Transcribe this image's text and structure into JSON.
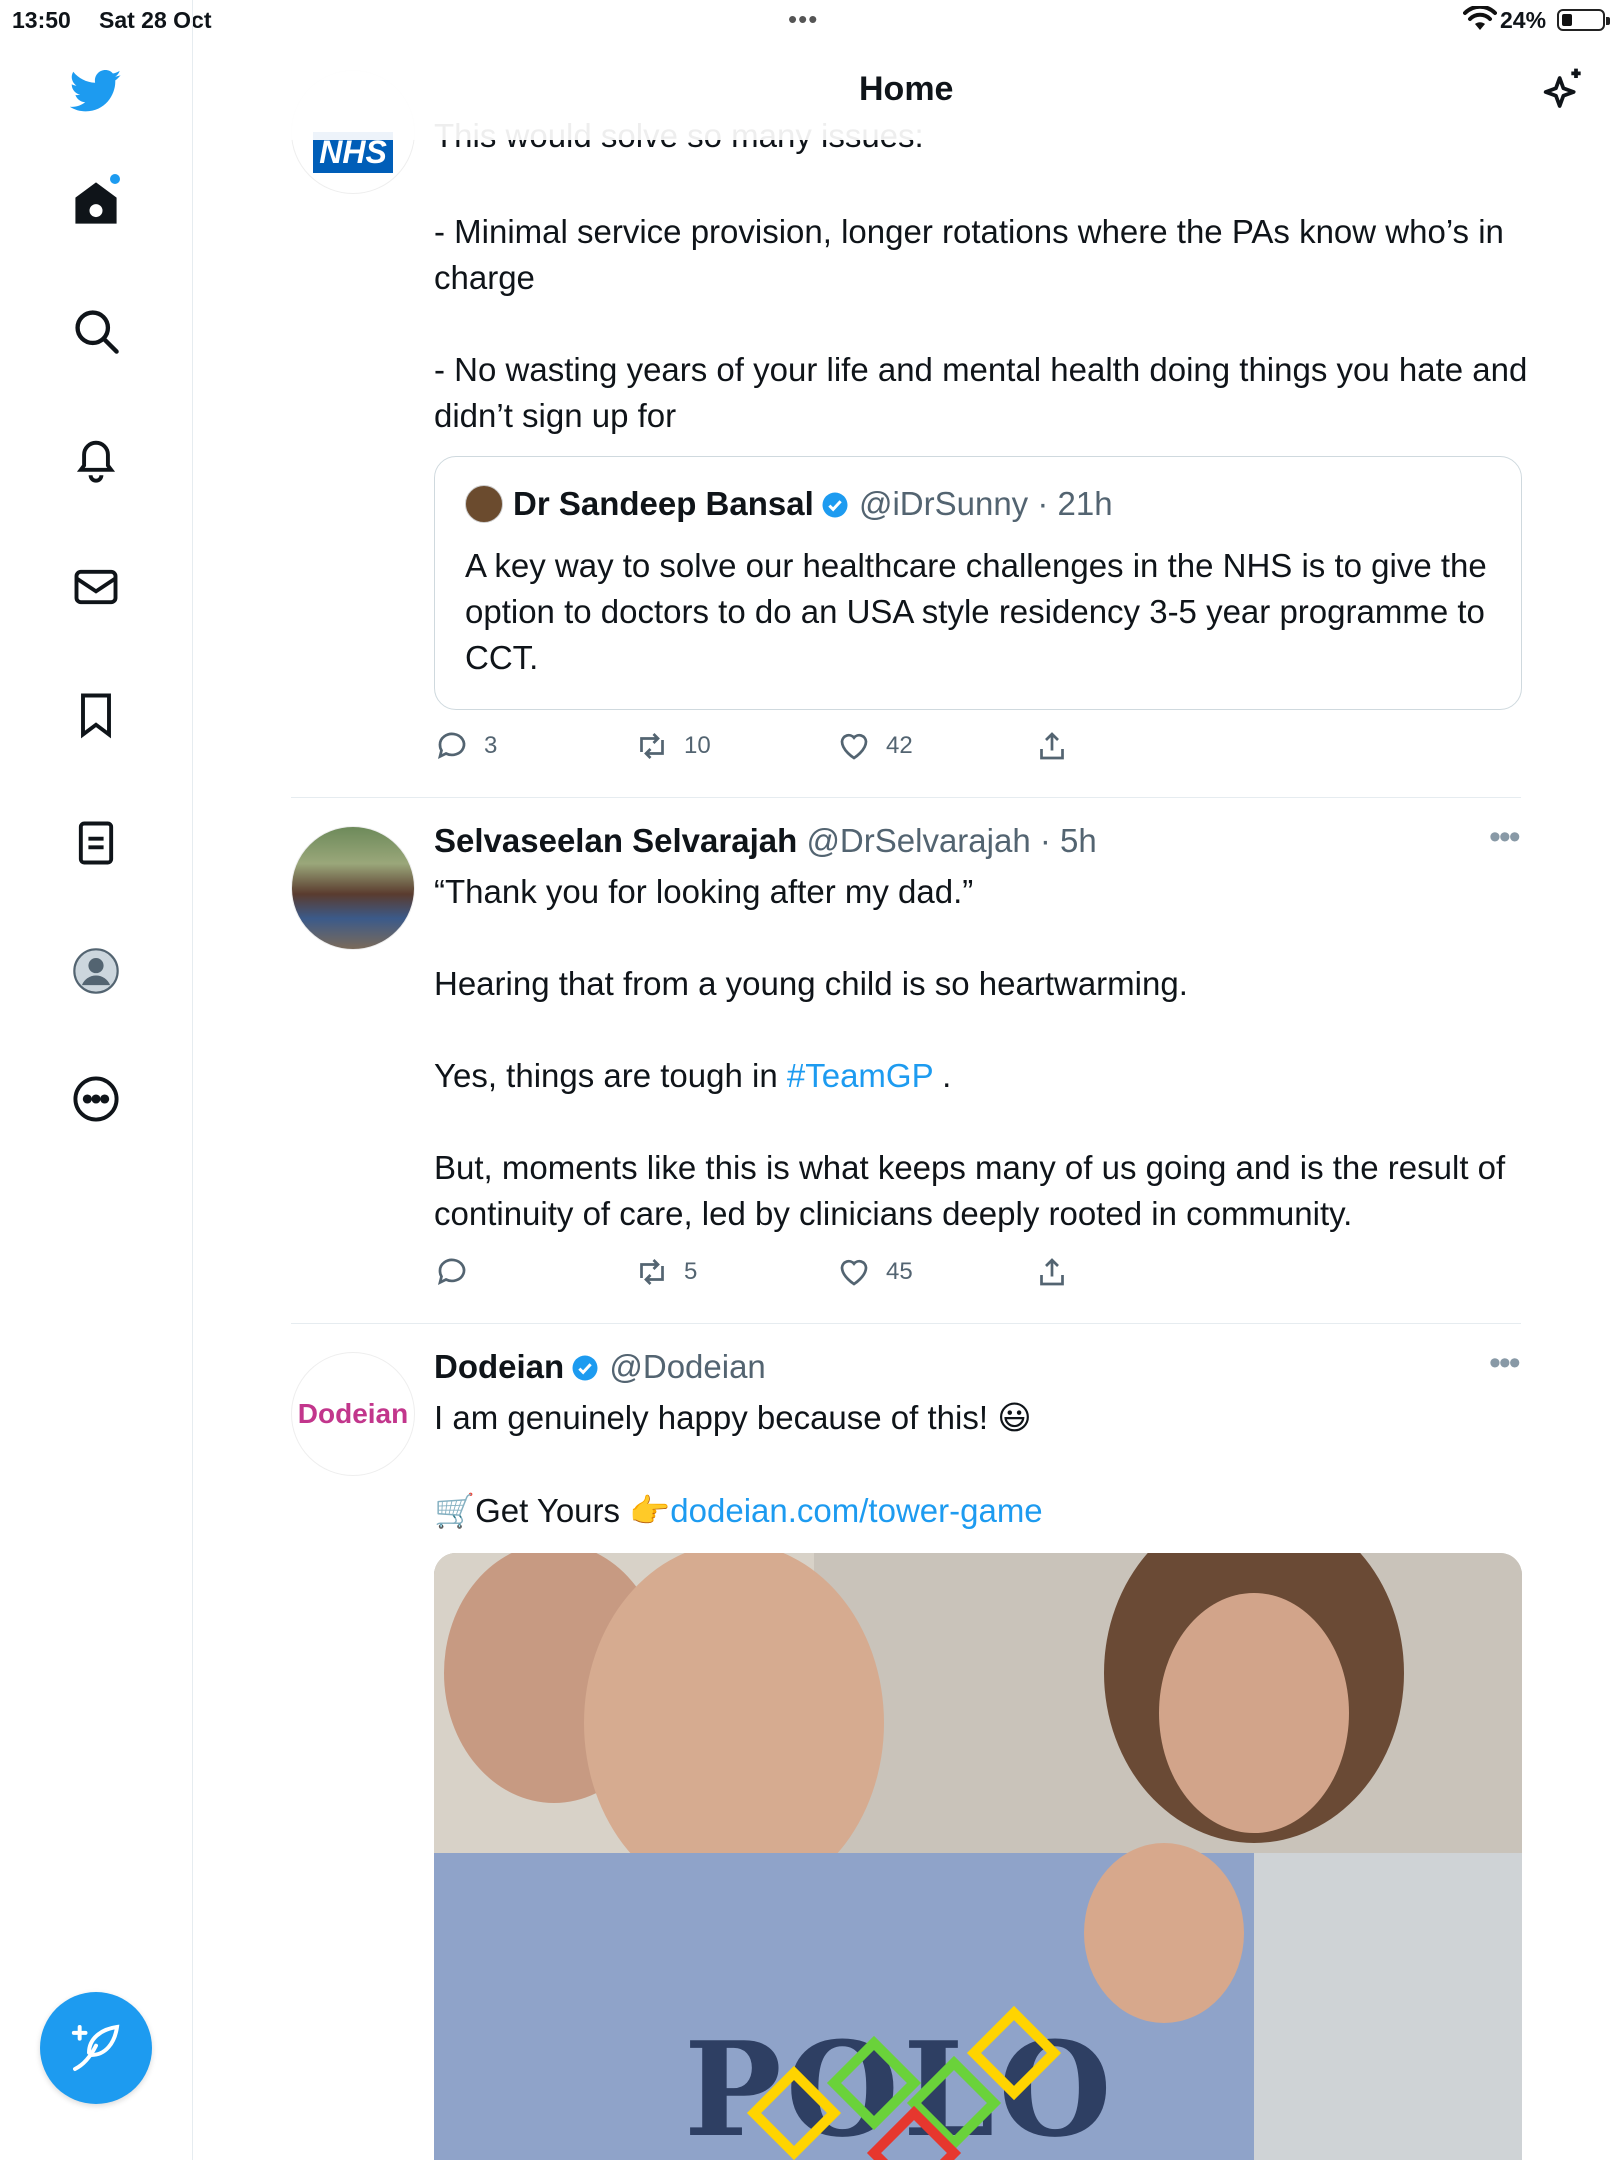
{
  "status_bar": {
    "time": "13:50",
    "date": "Sat 28 Oct",
    "battery": "24%"
  },
  "header": {
    "title": "Home"
  },
  "tweets": [
    {
      "avatar_label": "NHS",
      "text_top": "This would solve so many issues:",
      "text": "- Minimal service provision, longer rotations where the PAs know who’s in charge\n\n- No wasting years of your life and mental health doing things you hate and didn’t sign up for",
      "quote": {
        "name": "Dr Sandeep Bansal",
        "handle": "@iDrSunny",
        "time": "· 21h",
        "text": "A key way to solve our healthcare challenges in the NHS is to give the option to doctors to do an USA style residency 3-5 year programme to CCT."
      },
      "replies": "3",
      "retweets": "10",
      "likes": "42"
    },
    {
      "name": "Selvaseelan Selvarajah",
      "handle": "@DrSelvarajah",
      "time": "· 5h",
      "text_1": "“Thank you for looking after my dad.”\n\nHearing that from a young child is so heartwarming.\n\nYes, things are tough in ",
      "hashtag": "#TeamGP",
      "text_2": " .\n\nBut, moments like this is what keeps many of us going and is the result of continuity of care, led by clinicians deeply rooted in community.",
      "replies": "",
      "retweets": "5",
      "likes": "45"
    },
    {
      "avatar_label": "Dodeian",
      "name": "Dodeian",
      "handle": "@Dodeian",
      "text": "I am genuinely happy because of this! 😃",
      "cta": "🛒Get Yours 👉",
      "link": "dodeian.com/tower-game",
      "media_text": "POLO"
    }
  ],
  "colors": {
    "accent": "#1d9bf0",
    "text": "#0f1419",
    "muted": "#536471",
    "nhs_blue": "#005eb8",
    "dodeian_pink": "#c2368c"
  }
}
